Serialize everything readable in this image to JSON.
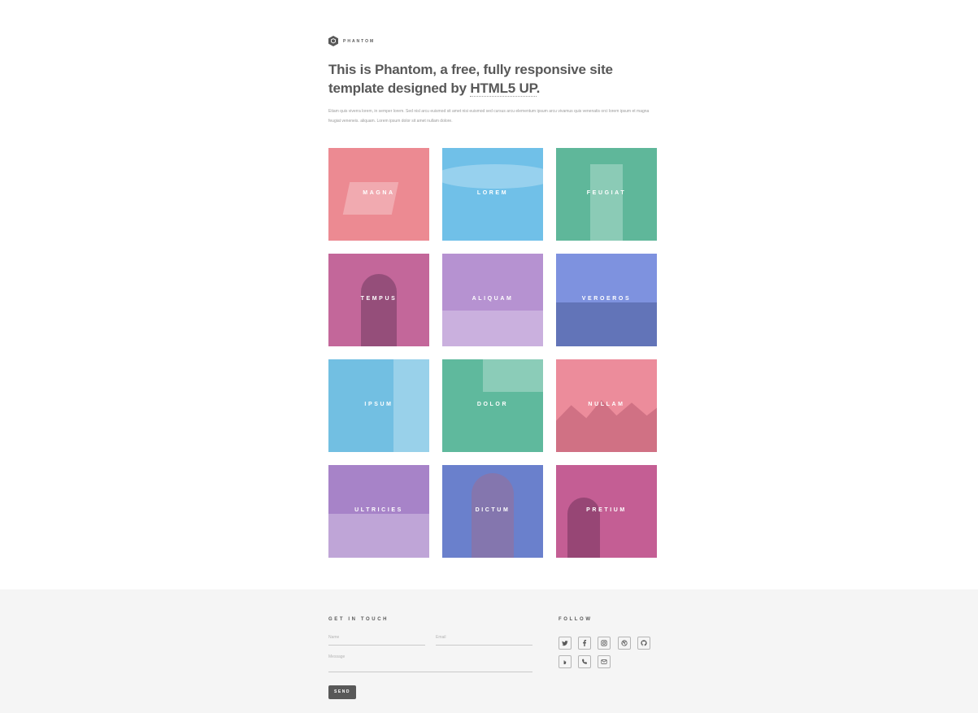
{
  "logo": {
    "icon": "phantom-hexagon-icon",
    "text": "PHANTOM"
  },
  "headline": {
    "part1": "This is Phantom, a free, fully responsive site template designed by ",
    "link": "HTML5 UP",
    "part2": "."
  },
  "intro": "Etiam quis viverra lorem, in semper lorem. Sed nisl arcu euismod sit amet nisi euismod sed cursus arcu elementum ipsum arcu vivamus quis venenatis orci lorem ipsum et magna feugiat veneneis. aliquam. Lorem ipsum dolor sit amet nullam dolore.",
  "tiles": [
    {
      "label": "MAGNA",
      "color": "#ec8a92"
    },
    {
      "label": "LOREM",
      "color": "#70c0e8"
    },
    {
      "label": "FEUGIAT",
      "color": "#5fb79a"
    },
    {
      "label": "TEMPUS",
      "color": "#c3679a"
    },
    {
      "label": "ALIQUAM",
      "color": "#b692d1"
    },
    {
      "label": "VEROEROS",
      "color": "#7e92df"
    },
    {
      "label": "IPSUM",
      "color": "#72bfe2"
    },
    {
      "label": "DOLOR",
      "color": "#5fb99d"
    },
    {
      "label": "NULLAM",
      "color": "#ec8c9b"
    },
    {
      "label": "ULTRICIES",
      "color": "#a783c8"
    },
    {
      "label": "DICTUM",
      "color": "#6a80cc"
    },
    {
      "label": "PRETIUM",
      "color": "#c45e94"
    }
  ],
  "footer": {
    "contact_title": "GET IN TOUCH",
    "name_placeholder": "Name",
    "email_placeholder": "Email",
    "message_placeholder": "Message",
    "send_label": "SEND",
    "follow_title": "FOLLOW",
    "social_icons": [
      "twitter-icon",
      "facebook-icon",
      "instagram-icon",
      "dribbble-icon",
      "github-icon",
      "500px-icon",
      "phone-icon",
      "envelope-icon"
    ]
  }
}
